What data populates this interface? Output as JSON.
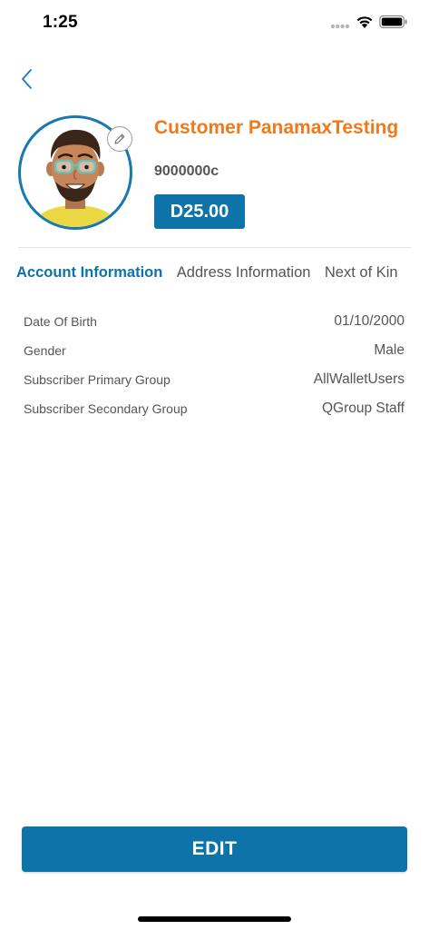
{
  "status_bar": {
    "time": "1:25"
  },
  "profile": {
    "name": "Customer PanamaxTesting",
    "id": "9000000c",
    "balance": "D25.00"
  },
  "tabs": [
    {
      "label": "Account Information",
      "active": true
    },
    {
      "label": "Address Information",
      "active": false
    },
    {
      "label": "Next of Kin",
      "active": false
    }
  ],
  "account_info": [
    {
      "label": "Date Of Birth",
      "value": "01/10/2000"
    },
    {
      "label": "Gender",
      "value": "Male"
    },
    {
      "label": "Subscriber Primary Group",
      "value": "AllWalletUsers"
    },
    {
      "label": "Subscriber Secondary Group",
      "value": "QGroup Staff"
    }
  ],
  "actions": {
    "edit_label": "EDIT"
  },
  "colors": {
    "primary": "#0e73a8",
    "accent": "#f07a1b"
  }
}
